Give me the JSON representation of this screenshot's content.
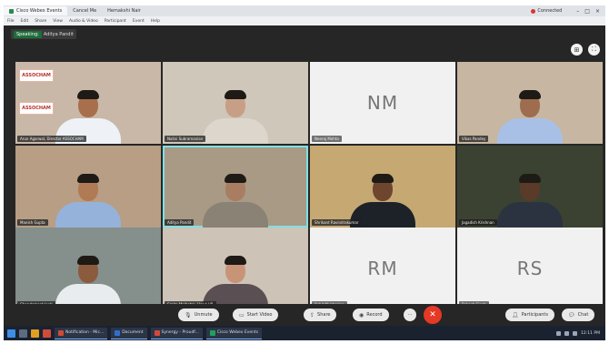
{
  "window": {
    "tabs": [
      {
        "label": "Cisco Webex Events"
      },
      {
        "label": "Cancel Me"
      },
      {
        "label": "Hemakshi Nair"
      }
    ],
    "status": "Connected",
    "controls": {
      "minimize": "–",
      "maximize": "□",
      "close": "×"
    }
  },
  "menubar": [
    "File",
    "Edit",
    "Share",
    "View",
    "Audio & Video",
    "Participant",
    "Event",
    "Help"
  ],
  "meeting": {
    "tag": "Speaking:",
    "speaker": "Aditya Pandit"
  },
  "tiles": [
    {
      "id": "t1",
      "label": "Arun Agarwal, Director ASSOCHAM",
      "kind": "video",
      "bg": "#c9b8a8",
      "shirt": "#eef2f7",
      "skin": "#a86f4c",
      "logo": "ASSOCHAM"
    },
    {
      "id": "t2",
      "label": "Nalini Subramanian",
      "kind": "video",
      "bg": "#cfc7b9",
      "shirt": "#ddd6cc",
      "skin": "#c79f86"
    },
    {
      "id": "t3",
      "label": "Neeraj Mehta",
      "kind": "initials",
      "initials": "NM"
    },
    {
      "id": "t4",
      "label": "Vikas Pandey",
      "kind": "video",
      "bg": "#c7b6a1",
      "shirt": "#a9c0e6",
      "skin": "#9e6d4f"
    },
    {
      "id": "t5",
      "label": "Manish Gupta",
      "kind": "video",
      "bg": "#b79e84",
      "shirt": "#95b3da",
      "skin": "#b07a55"
    },
    {
      "id": "t6",
      "label": "Aditya Pandit",
      "kind": "video",
      "bg": "#a89a85",
      "shirt": "#8a8275",
      "skin": "#a87d62",
      "speaking": true
    },
    {
      "id": "t7",
      "label": "Shrikant Ravindrakumar",
      "kind": "video",
      "bg": "#c6a873",
      "shirt": "#1d2128",
      "skin": "#6e4630"
    },
    {
      "id": "t8",
      "label": "Jagadish Krishnan",
      "kind": "video",
      "bg": "#3b4231",
      "shirt": "#2c3340",
      "skin": "#5a3a28"
    },
    {
      "id": "t9",
      "label": "Chandrakant Joshi",
      "kind": "video",
      "bg": "#858f8c",
      "shirt": "#e9ecef",
      "skin": "#8a5b3c"
    },
    {
      "id": "t10",
      "label": "Smita Malhotra, Head HR",
      "kind": "video",
      "bg": "#cdc3b6",
      "shirt": "#5a4f52",
      "skin": "#c89478"
    },
    {
      "id": "t11",
      "label": "Rohit Mukherjee",
      "kind": "initials",
      "initials": "RM"
    },
    {
      "id": "t12",
      "label": "Rakesh Singh",
      "kind": "initials",
      "initials": "RS"
    }
  ],
  "controls": {
    "unmute": "Unmute",
    "start_video": "Start Video",
    "share": "Share",
    "record": "Record",
    "more": "···",
    "participants": "Participants",
    "chat": "Chat"
  },
  "taskbar": {
    "items": [
      {
        "label": "Notification - Mic..."
      },
      {
        "label": "Document"
      },
      {
        "label": "Synergy - Proudf..."
      },
      {
        "label": "Cisco Webex Events"
      }
    ],
    "clock": "12:11 PM"
  },
  "colors": {
    "accent": "#7fe0e6",
    "end_call": "#e53925"
  }
}
